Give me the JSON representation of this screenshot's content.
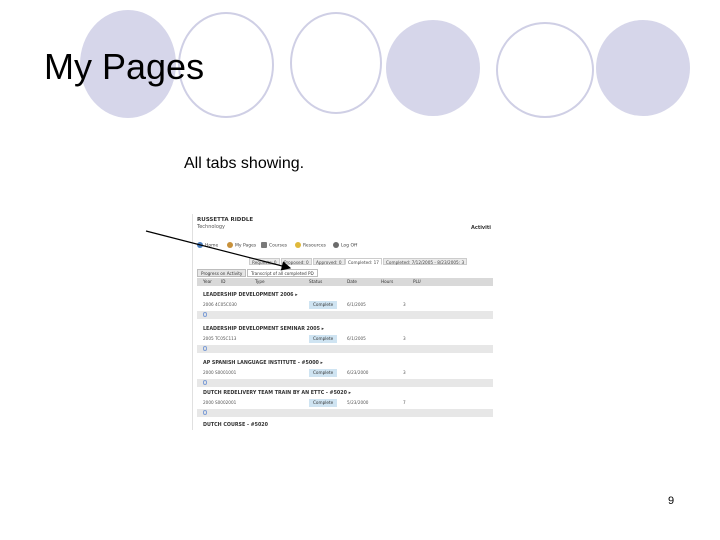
{
  "slide": {
    "title": "My Pages",
    "caption": "All tabs showing.",
    "page_number": "9"
  },
  "screenshot": {
    "user_name": "RUSSETTA RIDDLE",
    "user_dept": "Technology",
    "corner_text": "Activiti",
    "nav": [
      {
        "label": "Home",
        "icon": "home-icon",
        "color": "#4a7fc1"
      },
      {
        "label": "My Pages",
        "icon": "user-icon",
        "color": "#c8913a"
      },
      {
        "label": "Courses",
        "icon": "courses-icon",
        "color": "#7a7a7a"
      },
      {
        "label": "Resources",
        "icon": "resources-icon",
        "color": "#e0b93a"
      },
      {
        "label": "Log Off",
        "icon": "log-off-icon",
        "color": "#6b6b6b"
      }
    ],
    "status_tabs": [
      {
        "label": "Requests: 0"
      },
      {
        "label": "Proposed: 0"
      },
      {
        "label": "Approved: 0"
      },
      {
        "label": "Completed: 17",
        "active": true
      },
      {
        "label": "Completed: 7/12/2005 - 8/23/2005: 3"
      }
    ],
    "sub_tabs": [
      {
        "label": "Progress on Activity"
      },
      {
        "label": "Transcript of all completed PD",
        "active": true
      }
    ],
    "columns": [
      "Year",
      "ID",
      "Type",
      "Status",
      "Date",
      "Hours",
      "PLU"
    ],
    "records": [
      {
        "title": "LEADERSHIP DEVELOPMENT 2006 ▸",
        "id": "2006 4C05C030",
        "status": "Complete",
        "date": "6/1/2005",
        "hours": "3"
      },
      {
        "title": "LEADERSHIP DEVELOPMENT SEMINAR 2005 ▸",
        "id": "2005 TC05C113",
        "status": "Complete",
        "date": "6/1/2005",
        "hours": "3"
      },
      {
        "title": "AP SPANISH LANGUAGE INSTITUTE - #5000 ▸",
        "id": "2000 S0001001",
        "status": "Complete",
        "date": "6/23/2000",
        "hours": "3"
      },
      {
        "title": "DUTCH REDELIVERY TEAM TRAIN BY AN ETTC - #5020 ▸",
        "id": "2000 S0002001",
        "status": "Complete",
        "date": "5/23/2000",
        "hours": "7"
      },
      {
        "title": "DUTCH COURSE - #5020",
        "id": "",
        "status": "",
        "date": "",
        "hours": ""
      }
    ]
  }
}
